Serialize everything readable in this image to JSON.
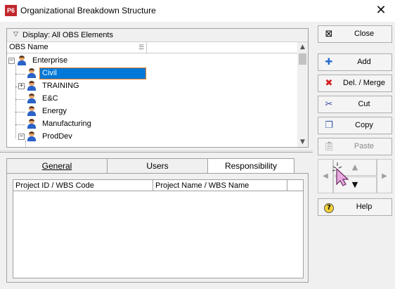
{
  "window": {
    "app_icon": "P6",
    "title": "Organizational Breakdown Structure",
    "close_glyph": "✕"
  },
  "tree": {
    "display_label": "Display: All OBS Elements",
    "column_header": "OBS Name",
    "nodes": [
      {
        "label": "Enterprise",
        "expander": "−"
      },
      {
        "label": "Civil",
        "selected": true
      },
      {
        "label": "TRAINING",
        "expander": "+"
      },
      {
        "label": "E&C"
      },
      {
        "label": "Energy"
      },
      {
        "label": "Manufacturing"
      },
      {
        "label": "ProdDev",
        "expander": "−"
      }
    ]
  },
  "tabs": [
    {
      "label": "General",
      "active": false
    },
    {
      "label": "Users",
      "active": false
    },
    {
      "label": "Responsibility",
      "active": true
    }
  ],
  "grid": {
    "columns": [
      "Project ID / WBS Code",
      "Project Name / WBS Name"
    ]
  },
  "buttons": {
    "close": "Close",
    "add": "Add",
    "delete_merge": "Del. / Merge",
    "cut": "Cut",
    "copy": "Copy",
    "paste": "Paste",
    "help": "Help"
  },
  "icons": {
    "close": "close-window-icon",
    "add": "plus-icon",
    "delete": "red-x-icon",
    "cut": "scissors-icon",
    "copy": "copy-icon",
    "paste": "paste-icon",
    "help": "help-question-icon"
  }
}
